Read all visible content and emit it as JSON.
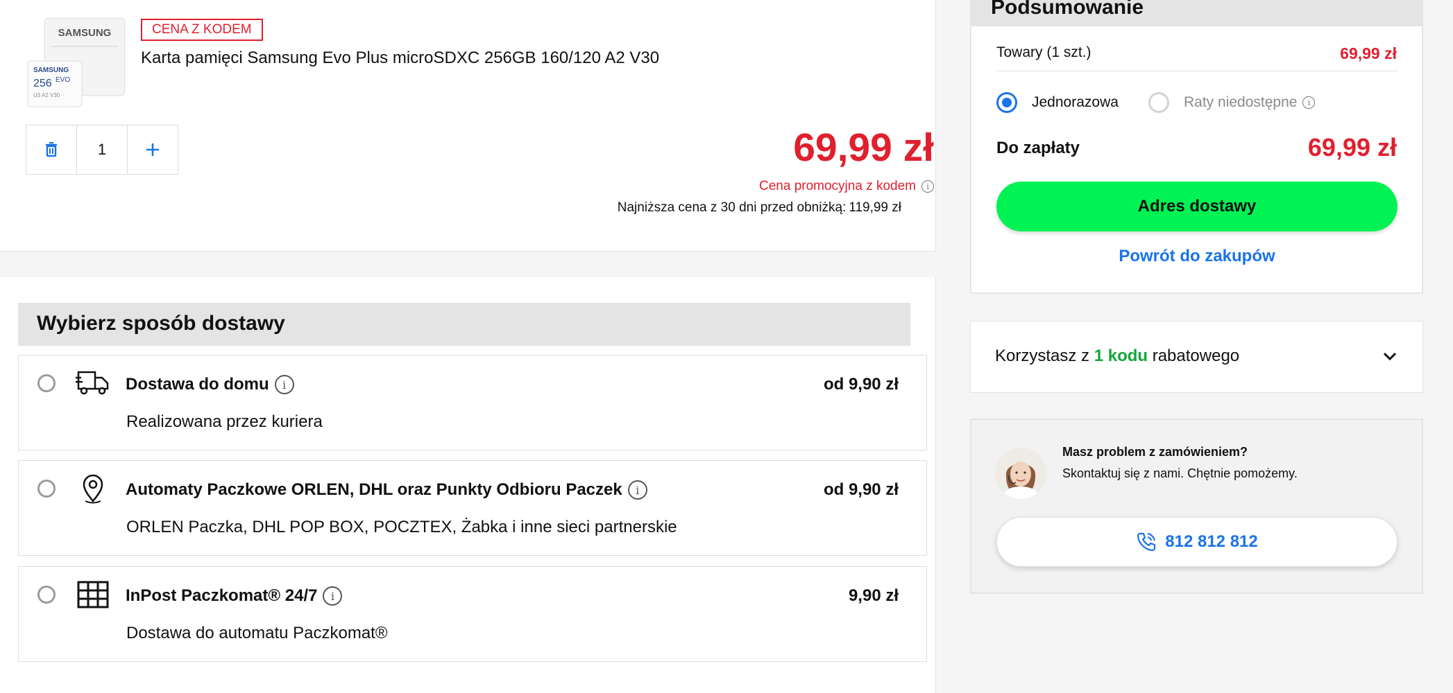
{
  "product": {
    "image_brand": "SAMSUNG",
    "badge": "CENA Z KODEM",
    "name": "Karta pamięci Samsung Evo Plus microSDXC 256GB 160/120 A2 V30",
    "quantity": "1",
    "price": "69,99 zł",
    "promo_label": "Cena promocyjna z kodem",
    "lowest_price_label": "Najniższa cena z 30 dni przed obniżką:",
    "lowest_price_value": "119,99 zł"
  },
  "delivery": {
    "title": "Wybierz sposób dostawy",
    "options": [
      {
        "title": "Dostawa do domu",
        "price": "od 9,90 zł",
        "subtitle": "Realizowana przez kuriera",
        "icon": "truck-icon",
        "selected": false
      },
      {
        "title": "Automaty Paczkowe ORLEN, DHL oraz Punkty Odbioru Paczek",
        "price": "od 9,90 zł",
        "subtitle": "ORLEN Paczka, DHL POP BOX, POCZTEX, Żabka i inne sieci partnerskie",
        "icon": "map-pin-icon",
        "selected": false
      },
      {
        "title": "InPost Paczkomat® 24/7",
        "price": "9,90 zł",
        "subtitle": "Dostawa do automatu Paczkomat®",
        "icon": "parcel-locker-icon",
        "selected": false
      }
    ]
  },
  "summary": {
    "title": "Podsumowanie",
    "items_label": "Towary (1 szt.)",
    "items_value": "69,99 zł",
    "payment_once": "Jednorazowa",
    "payment_installments": "Raty niedostępne",
    "total_label": "Do zapłaty",
    "total_value": "69,99 zł",
    "cta": "Adres dostawy",
    "back_link": "Powrót do zakupów"
  },
  "coupon": {
    "prefix": "Korzystasz z",
    "highlight": "1 kodu",
    "suffix": "rabatowego"
  },
  "help": {
    "title": "Masz problem z zamówieniem?",
    "subtitle": "Skontaktuj się z nami. Chętnie pomożemy.",
    "phone": "812 812 812"
  },
  "colors": {
    "price_red": "#e0202f",
    "accent_blue": "#1a73e8",
    "cta_green": "#00f253",
    "coupon_green": "#13a538"
  }
}
